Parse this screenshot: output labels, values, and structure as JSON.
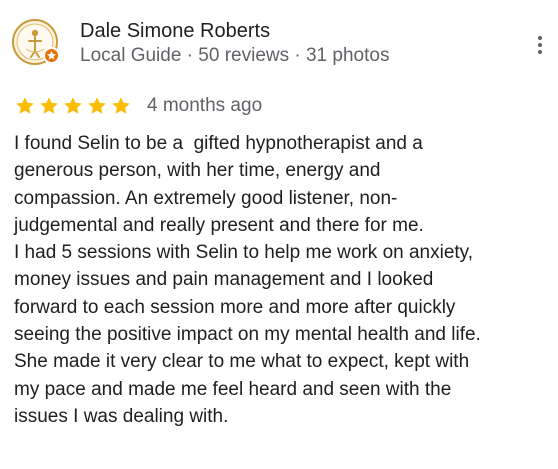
{
  "review": {
    "author": {
      "name": "Dale Simone Roberts",
      "meta": "Local Guide · 50 reviews · 31 photos",
      "avatar_icon": "user-avatar-icon",
      "badge_icon": "local-guide-star-icon"
    },
    "menu_icon": "more-vert-icon",
    "rating": {
      "stars": 5,
      "max": 5,
      "color": "#fbbc04"
    },
    "date": "4 months ago",
    "text_lines": [
      "I found Selin to be a  gifted hypnotherapist and a",
      "generous person, with her time, energy and",
      "compassion. An extremely good listener, non-",
      "judgemental and really present and there for me.",
      "I had 5 sessions with Selin to help me work on anxiety,",
      "money issues and pain management and I looked",
      "forward to each session more and more after quickly",
      "seeing the positive impact on my mental health and life.",
      "She made it very clear to me what to expect, kept with",
      "my pace and made me feel heard and seen with the",
      "issues I was dealing with."
    ]
  }
}
